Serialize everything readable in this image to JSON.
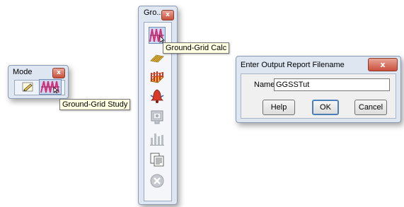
{
  "mode_window": {
    "title": "Mode",
    "close_label": "x",
    "buttons": [
      {
        "icon": "pencil-icon"
      },
      {
        "icon": "ground-grid-study-icon"
      }
    ],
    "tooltip": "Ground-Grid Study"
  },
  "ground_window": {
    "title": "Gro...",
    "close_label": "x",
    "tooltip": "Ground-Grid Calc",
    "tools": [
      {
        "icon": "ground-grid-calc-icon"
      },
      {
        "icon": "grid-layout-icon"
      },
      {
        "icon": "grid-potential-icon"
      },
      {
        "icon": "alert-bell-icon"
      },
      {
        "icon": "report-viewer-icon"
      },
      {
        "icon": "bar-chart-icon"
      },
      {
        "icon": "report-pages-icon"
      },
      {
        "icon": "stop-icon"
      }
    ]
  },
  "report_dialog": {
    "title": "Enter Output Report Filename",
    "close_label": "x",
    "name_label": "Name",
    "name_value": "GGSSTut",
    "help_label": "Help",
    "ok_label": "OK",
    "cancel_label": "Cancel"
  }
}
